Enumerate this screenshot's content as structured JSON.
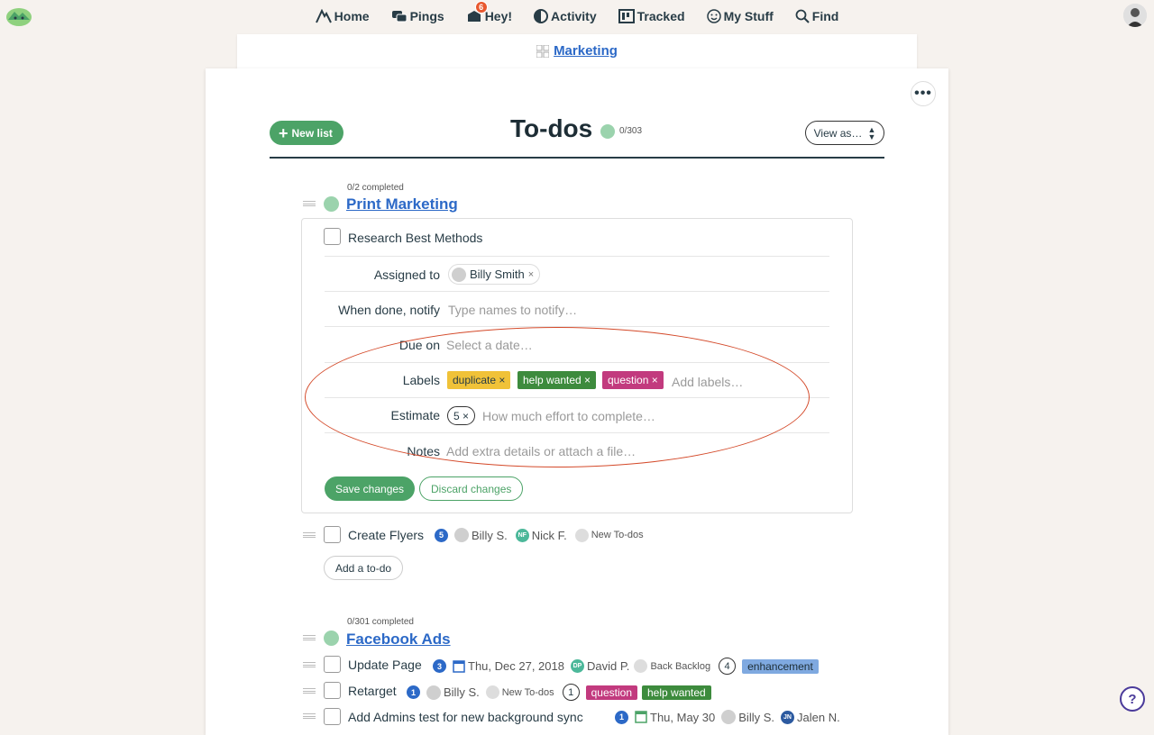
{
  "nav": {
    "home": "Home",
    "pings": "Pings",
    "hey": "Hey!",
    "hey_badge": "6",
    "activity": "Activity",
    "tracked": "Tracked",
    "my_stuff": "My Stuff",
    "find": "Find"
  },
  "breadcrumb": {
    "project": "Marketing"
  },
  "header": {
    "new_list": "New list",
    "title": "To-dos",
    "count": "0/303",
    "view_as": "View as…"
  },
  "list1": {
    "meta": "0/2 completed",
    "title": "Print Marketing",
    "editing_todo": {
      "name": "Research Best Methods",
      "assigned_label": "Assigned to",
      "assignee": "Billy Smith",
      "notify_label": "When done, notify",
      "notify_placeholder": "Type names to notify…",
      "due_label": "Due on",
      "due_placeholder": "Select a date…",
      "labels_label": "Labels",
      "labels": [
        {
          "text": "duplicate ×",
          "color": "#f0c238",
          "fg": "#283c46"
        },
        {
          "text": "help wanted ×",
          "color": "#3d8b3d",
          "fg": "#ffffff"
        },
        {
          "text": "question ×",
          "color": "#c23a7e",
          "fg": "#ffffff"
        }
      ],
      "labels_placeholder": "Add labels…",
      "estimate_label": "Estimate",
      "estimate_value": "5 ×",
      "estimate_placeholder": "How much effort to complete…",
      "notes_label": "Notes",
      "notes_placeholder": "Add extra details or attach a file…",
      "save": "Save changes",
      "discard": "Discard changes"
    },
    "todos": [
      {
        "name": "Create Flyers",
        "badge": "5",
        "person1": "Billy S.",
        "initials2": "NF",
        "person2": "Nick F.",
        "column": "New To-dos"
      }
    ],
    "add_todo": "Add a to-do"
  },
  "list2": {
    "meta": "0/301 completed",
    "title": "Facebook Ads",
    "todos": [
      {
        "name": "Update Page",
        "badge": "3",
        "date": "Thu, Dec 27, 2018",
        "initials": "DP",
        "person": "David P.",
        "column": "Back Backlog",
        "estimate": "4",
        "tag": "enhancement"
      },
      {
        "name": "Retarget",
        "badge": "1",
        "person": "Billy S.",
        "column": "New To-dos",
        "estimate": "1",
        "tag1": "question",
        "tag2": "help wanted"
      },
      {
        "name": "Add Admins test for new background sync",
        "badge": "1",
        "date": "Thu, May 30",
        "person": "Billy S.",
        "initials2": "JN",
        "person2": "Jalen N."
      }
    ]
  },
  "colors": {
    "accent_green": "#4ca367",
    "link_blue": "#2c69c7",
    "annotation_red": "#d44a2a"
  },
  "help": "?"
}
